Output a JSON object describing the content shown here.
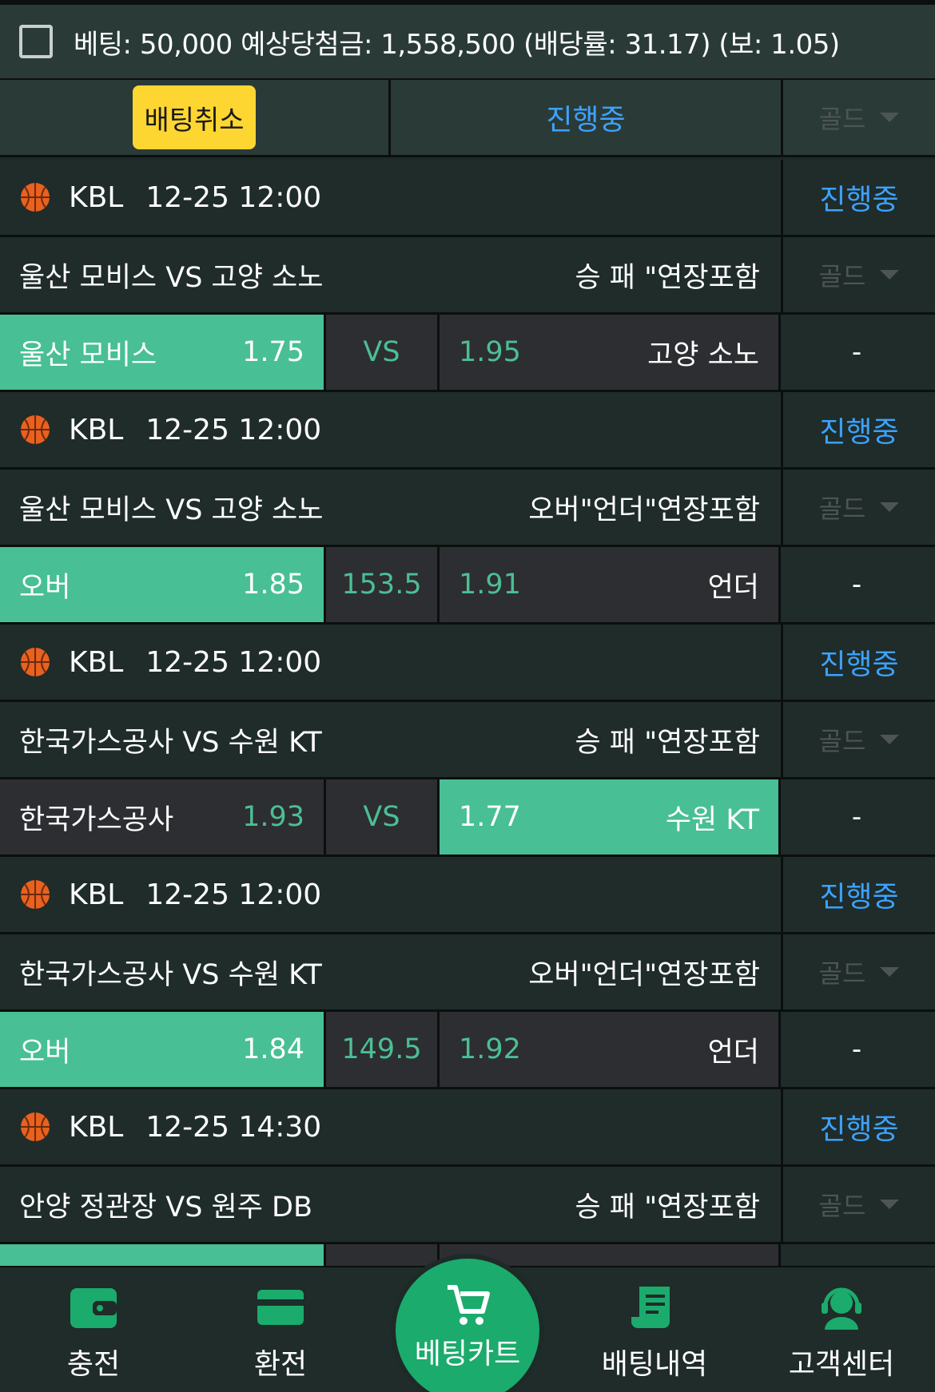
{
  "topbar": {
    "summary": "베팅: 50,000 예상당첨금: 1,558,500 (배당률: 31.17) (보: 1.05)"
  },
  "actions": {
    "cancel_label": "배팅취소",
    "status_label": "진행중",
    "gold_label": "골드"
  },
  "games": [
    {
      "league": "KBL",
      "datetime": "12-25 12:00",
      "status": "진행중",
      "match": "울산 모비스 VS 고양 소노",
      "market": "승 패 \"연장포함",
      "dropdown": "골드",
      "home_label": "울산 모비스",
      "home_odds": "1.75",
      "mid": "VS",
      "away_odds": "1.95",
      "away_label": "고양 소노",
      "extra": "-",
      "selected": "home"
    },
    {
      "league": "KBL",
      "datetime": "12-25 12:00",
      "status": "진행중",
      "match": "울산 모비스 VS 고양 소노",
      "market": "오버\"언더\"연장포함",
      "dropdown": "골드",
      "home_label": "오버",
      "home_odds": "1.85",
      "mid": "153.5",
      "away_odds": "1.91",
      "away_label": "언더",
      "extra": "-",
      "selected": "home"
    },
    {
      "league": "KBL",
      "datetime": "12-25 12:00",
      "status": "진행중",
      "match": "한국가스공사 VS 수원 KT",
      "market": "승 패 \"연장포함",
      "dropdown": "골드",
      "home_label": "한국가스공사",
      "home_odds": "1.93",
      "mid": "VS",
      "away_odds": "1.77",
      "away_label": "수원 KT",
      "extra": "-",
      "selected": "away"
    },
    {
      "league": "KBL",
      "datetime": "12-25 12:00",
      "status": "진행중",
      "match": "한국가스공사 VS 수원 KT",
      "market": "오버\"언더\"연장포함",
      "dropdown": "골드",
      "home_label": "오버",
      "home_odds": "1.84",
      "mid": "149.5",
      "away_odds": "1.92",
      "away_label": "언더",
      "extra": "-",
      "selected": "home"
    },
    {
      "league": "KBL",
      "datetime": "12-25 14:30",
      "status": "진행중",
      "match": "안양 정관장 VS 원주 DB",
      "market": "승 패 \"연장포함",
      "dropdown": "골드"
    }
  ],
  "nav": {
    "charge": "충전",
    "exchange": "환전",
    "betcart": "베팅카트",
    "history": "배팅내역",
    "support": "고객센터"
  },
  "colors": {
    "accent_green": "#48bf95",
    "status_blue": "#3da2ff",
    "cancel_yellow": "#fed632",
    "nav_green": "#1bab6c"
  }
}
